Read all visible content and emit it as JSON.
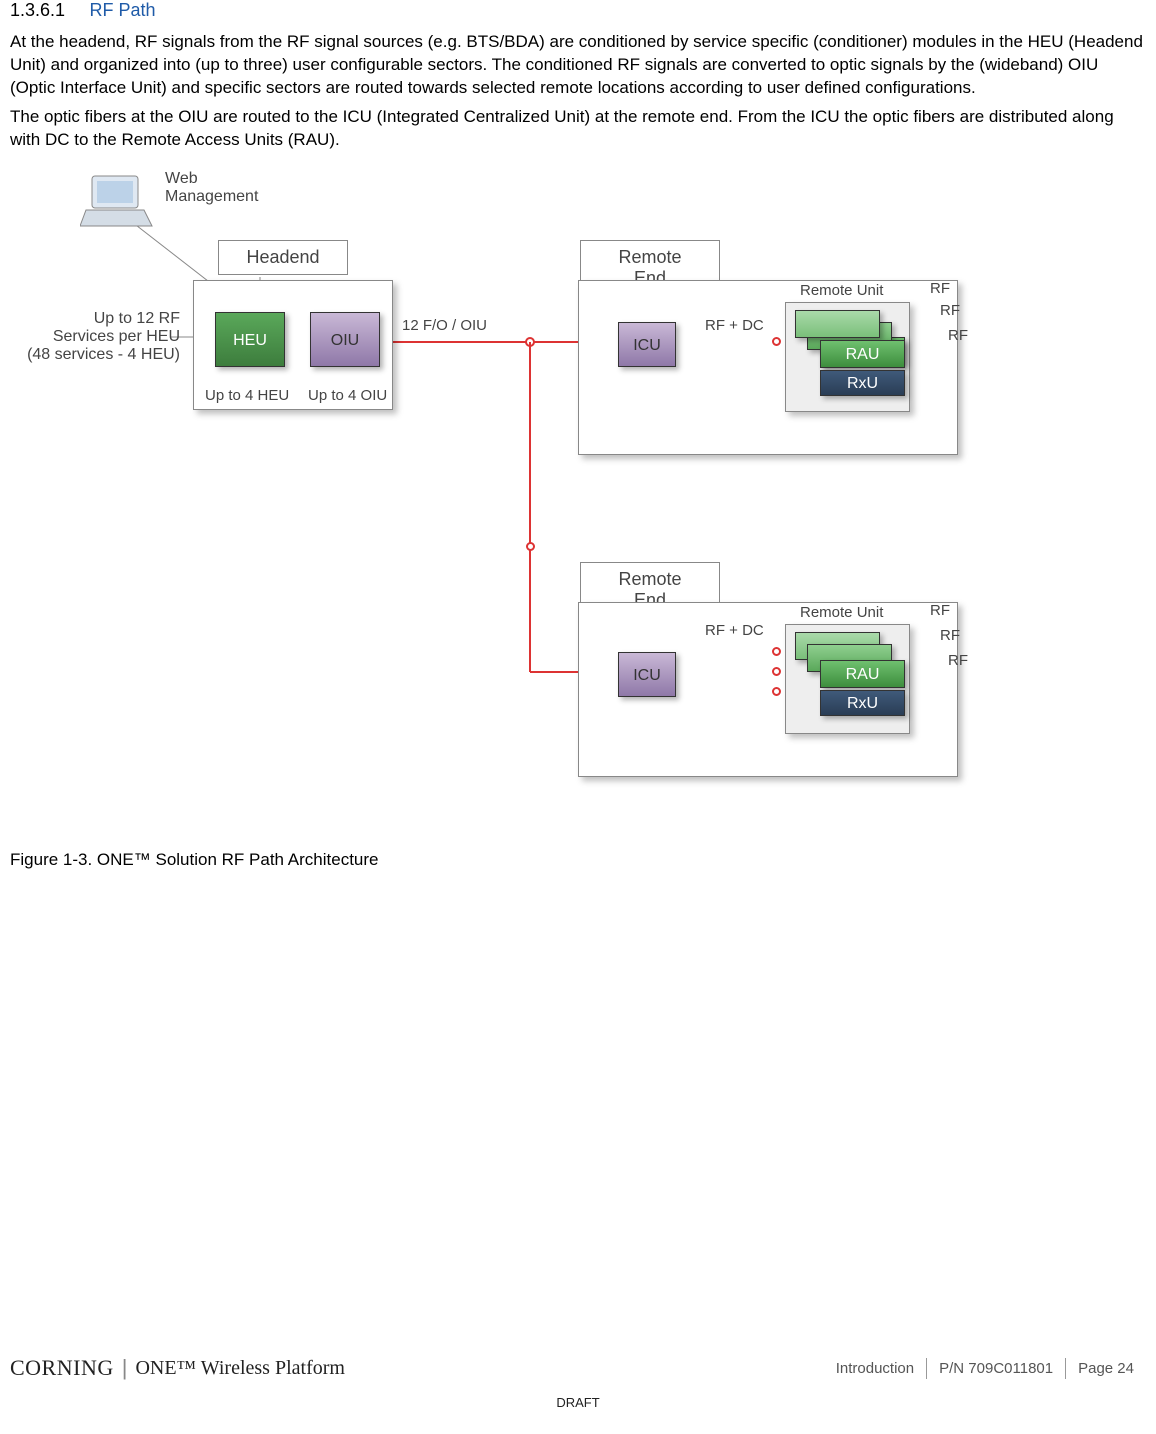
{
  "section": {
    "number": "1.3.6.1",
    "title": "RF Path"
  },
  "paragraphs": {
    "p1": "At the headend, RF signals from the RF signal sources (e.g. BTS/BDA) are conditioned by service specific (conditioner) modules in the HEU (Headend Unit) and organized into (up to three) user configurable sectors. The conditioned RF signals are converted to optic signals by the (wideband) OIU (Optic Interface Unit) and specific sectors are routed towards selected remote locations according to user defined configurations.",
    "p2": "The optic fibers at the OIU are routed to the ICU (Integrated Centralized Unit) at the remote end. From the ICU the optic fibers are distributed along with DC to the Remote Access Units (RAU)."
  },
  "diagram": {
    "web_mgmt": "Web\nManagement",
    "headend_label": "Headend",
    "remote_end_label": "Remote End",
    "services_text": "Up to 12 RF\nServices per HEU\n(48 services - 4 HEU)",
    "heu": "HEU",
    "oiu": "OIU",
    "icu": "ICU",
    "rau": "RAU",
    "rxu": "RxU",
    "up_to_4_heu": "Up to 4 HEU",
    "up_to_4_oiu": "Up to 4 OIU",
    "fo_label": "12 F/O / OIU",
    "rf_dc": "RF + DC",
    "remote_unit": "Remote Unit",
    "rf": "RF"
  },
  "caption": "Figure 1-3. ONE™ Solution RF Path Architecture",
  "footer": {
    "brand_left": "CORNING",
    "brand_right": "ONE™ Wireless Platform",
    "intro": "Introduction",
    "pn": "P/N 709C011801",
    "page": "Page 24",
    "draft": "DRAFT"
  }
}
